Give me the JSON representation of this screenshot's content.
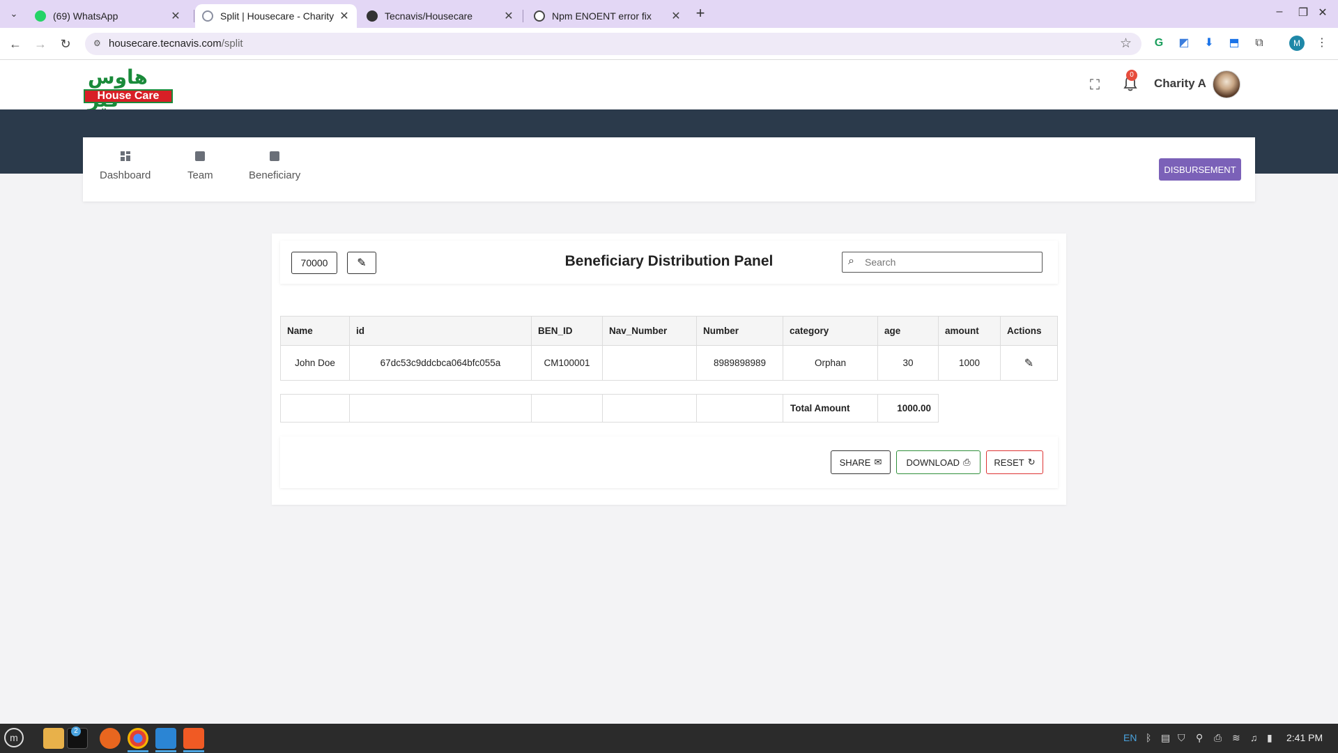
{
  "browser": {
    "tabs": [
      {
        "title": "(69) WhatsApp",
        "favicon_color": "#25d366"
      },
      {
        "title": "Split | Housecare - Charity Or",
        "favicon_color": "#8a8fa0"
      },
      {
        "title": "Tecnavis/Housecare",
        "favicon_color": "#333333"
      },
      {
        "title": "Npm ENOENT error fix",
        "favicon_color": "#444444"
      }
    ],
    "url_host": "housecare.tecnavis.com",
    "url_path": "/split"
  },
  "header": {
    "logo_arabic": "هاوس كير",
    "logo_text": "House Care",
    "notification_count": "0",
    "user_name": "Charity A"
  },
  "nav": {
    "items": [
      {
        "label": "Dashboard",
        "icon": "dashboard-icon"
      },
      {
        "label": "Team",
        "icon": "badge-icon"
      },
      {
        "label": "Beneficiary",
        "icon": "badge-icon"
      }
    ],
    "disbursement_label": "DISBURSEMENT"
  },
  "panel": {
    "amount": "70000",
    "title": "Beneficiary Distribution Panel",
    "search_placeholder": "Search",
    "columns": [
      "Name",
      "id",
      "BEN_ID",
      "Nav_Number",
      "Number",
      "category",
      "age",
      "amount",
      "Actions"
    ],
    "rows": [
      {
        "name": "John Doe",
        "id": "67dc53c9ddcbca064bfc055a",
        "ben_id": "CM100001",
        "nav_number": "",
        "number": "8989898989",
        "category": "Orphan",
        "age": "30",
        "amount": "1000"
      }
    ],
    "total_label": "Total Amount",
    "total_value": "1000.00",
    "buttons": {
      "share": "SHARE",
      "download": "DOWNLOAD",
      "reset": "RESET"
    }
  },
  "taskbar": {
    "badge_count": "2",
    "lang": "EN",
    "time": "2:41 PM"
  },
  "colors": {
    "accent": "#7b61b8",
    "header_band": "#2b3a4b",
    "download_border": "#2f8f3a",
    "reset_border": "#dd3333"
  }
}
